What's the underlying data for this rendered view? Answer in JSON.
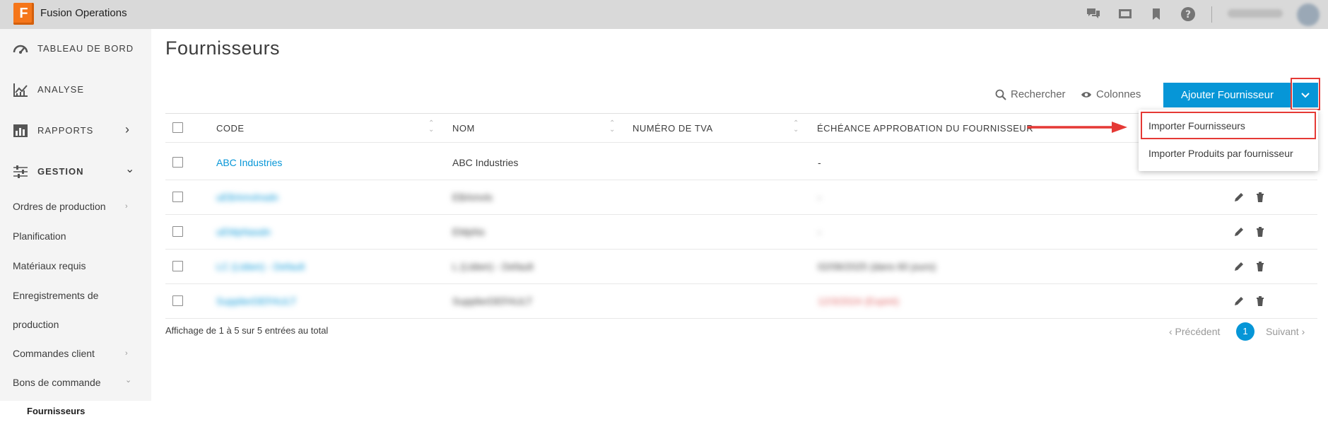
{
  "app": {
    "title": "Fusion Operations",
    "logo_letter": "F"
  },
  "topbar": {
    "icons": [
      "chat-icon",
      "screen-icon",
      "bookmark-icon",
      "help-icon"
    ]
  },
  "sidebar": {
    "main_items": [
      {
        "label": "TABLEAU DE BORD",
        "icon": "dashboard-icon"
      },
      {
        "label": "ANALYSE",
        "icon": "analytics-icon"
      },
      {
        "label": "RAPPORTS",
        "icon": "reports-icon",
        "chevron": "›"
      },
      {
        "label": "GESTION",
        "icon": "sliders-icon",
        "chevron": "⌄"
      }
    ],
    "sub_items": [
      {
        "label": "Ordres de production",
        "chevron": "›"
      },
      {
        "label": "Planification"
      },
      {
        "label": "Matériaux requis"
      },
      {
        "label": "Enregistrements de"
      },
      {
        "label": "production"
      },
      {
        "label": "Commandes client",
        "chevron": "›"
      },
      {
        "label": "Bons de commande",
        "chevron": "⌄"
      }
    ],
    "active_item": "Fournisseurs"
  },
  "page": {
    "title": "Fournisseurs",
    "search_label": "Rechercher",
    "columns_label": "Colonnes",
    "add_button": "Ajouter Fournisseur"
  },
  "dropdown": {
    "items": [
      "Importer Fournisseurs",
      "Importer Produits par fournisseur"
    ]
  },
  "table": {
    "headers": [
      "CODE",
      "NOM",
      "NUMÉRO DE TVA",
      "ÉCHÉANCE APPROBATION DU FOURNISSEUR"
    ],
    "rows": [
      {
        "code": "ABC Industries",
        "name": "ABC Industries",
        "vat": "",
        "due": "-",
        "due_status": "normal"
      },
      {
        "code": "uEBAmvlnsdn",
        "name": "EBAmvls",
        "vat": "",
        "due": "-",
        "due_status": "normal"
      },
      {
        "code": "uEMpNasdn",
        "name": "EMpNs",
        "vat": "",
        "due": "-",
        "due_status": "normal"
      },
      {
        "code": "LC (Ltdwn) - Default",
        "name": "L (Ltdwn) - Default",
        "vat": "",
        "due": "02/06/2025 (dans 60 jours)",
        "due_status": "normal"
      },
      {
        "code": "SupplierDEFAULT",
        "name": "SupplierDEFAULT",
        "vat": "",
        "due": "12/3/2024 (Expiré)",
        "due_status": "expired"
      }
    ]
  },
  "footer": {
    "info": "Affichage de 1 à 5 sur 5 entrées au total",
    "prev": "‹ Précédent",
    "page": "1",
    "next": "Suivant ›"
  },
  "colors": {
    "accent": "#0696d7",
    "brand": "#f5761a",
    "annotation": "#e53935",
    "expired": "#e06666"
  }
}
